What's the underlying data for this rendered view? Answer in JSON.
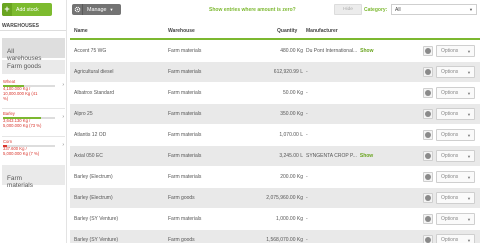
{
  "sidebar": {
    "add_stock_label": "Add stock",
    "warehouses_heading": "WAREHOUSES",
    "items": [
      {
        "label": "All\nwarehouses"
      },
      {
        "label": "Farm goods"
      },
      {
        "label": "Farm\nmaterials"
      }
    ],
    "stocks": [
      {
        "name": "Wheat",
        "values": "4,100.000 Kg /\n10,000.000 Kg (41\n%)",
        "fill": 0.41,
        "color": "#7cb830"
      },
      {
        "name": "Barley",
        "values": "3,643.130 Kg /\n5,000.000 Kg (73 %)",
        "fill": 0.73,
        "color": "#7cb830"
      },
      {
        "name": "Corn",
        "values": "337.600 Kg /\n5,000.000 Kg (7 %)",
        "fill": 0.07,
        "color": "#d9342b"
      }
    ]
  },
  "toolbar": {
    "manage_label": "Manage",
    "zero_label": "Show entries where amount is zero?",
    "hide_label": "Hide",
    "category_label": "Category:",
    "category_value": "All"
  },
  "table": {
    "headers": {
      "name": "Name",
      "warehouse": "Warehouse",
      "quantity": "Quantity",
      "manufacturer": "Manufacturer"
    },
    "options_label": "Options",
    "show_label": "Show",
    "rows": [
      {
        "name": "Accent 75 WG",
        "warehouse": "Farm materials",
        "quantity": "480.00 Kg",
        "manufacturer": "Du Pont International...",
        "show": true
      },
      {
        "name": "Agricultural diesel",
        "warehouse": "Farm materials",
        "quantity": "612,920.99 L",
        "manufacturer": "-",
        "show": false
      },
      {
        "name": "Albatrox Standard",
        "warehouse": "Farm materials",
        "quantity": "50.00 Kg",
        "manufacturer": "-",
        "show": false
      },
      {
        "name": "Alpro 25",
        "warehouse": "Farm materials",
        "quantity": "350.00 Kg",
        "manufacturer": "-",
        "show": false
      },
      {
        "name": "Atlantis 12 OD",
        "warehouse": "Farm materials",
        "quantity": "1,070.00 L",
        "manufacturer": "-",
        "show": false
      },
      {
        "name": "Axial 050 EC",
        "warehouse": "Farm materials",
        "quantity": "3,245.00 L",
        "manufacturer": "SYNGENTA CROP P...",
        "show": true
      },
      {
        "name": "Barley (Electrum)",
        "warehouse": "Farm materials",
        "quantity": "200.00 Kg",
        "manufacturer": "-",
        "show": false
      },
      {
        "name": "Barley (Electrum)",
        "warehouse": "Farm goods",
        "quantity": "2,075,960.00 Kg",
        "manufacturer": "-",
        "show": false
      },
      {
        "name": "Barley (SY Venture)",
        "warehouse": "Farm materials",
        "quantity": "1,000.00 Kg",
        "manufacturer": "-",
        "show": false
      },
      {
        "name": "Barley (SY Venture)",
        "warehouse": "Farm goods",
        "quantity": "1,568,070.00 Kg",
        "manufacturer": "-",
        "show": false
      }
    ]
  }
}
